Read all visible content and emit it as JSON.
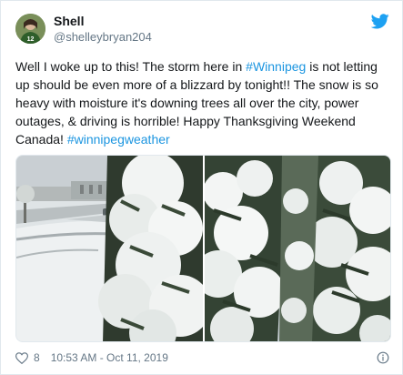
{
  "user": {
    "display_name": "Shell",
    "handle": "@shelleybryan204"
  },
  "tweet": {
    "text_before_tag1": "Well I woke up to this! The storm here in ",
    "tag1": "#Winnipeg",
    "text_after_tag1": " is not letting up should be even more of a blizzard by tonight!! The snow is so heavy with moisture it's downing trees all over the city, power outages, & driving is horrible! Happy Thanksgiving Weekend Canada! ",
    "tag2": "#winnipegweather"
  },
  "footer": {
    "like_count": "8",
    "timestamp": "10:53 AM - Oct 11, 2019"
  },
  "colors": {
    "link": "#1b95e0",
    "twitter_blue": "#1da1f2",
    "muted": "#657786"
  },
  "icons": {
    "like": "heart-icon",
    "brand": "twitter-bird-icon",
    "info": "info-icon"
  }
}
